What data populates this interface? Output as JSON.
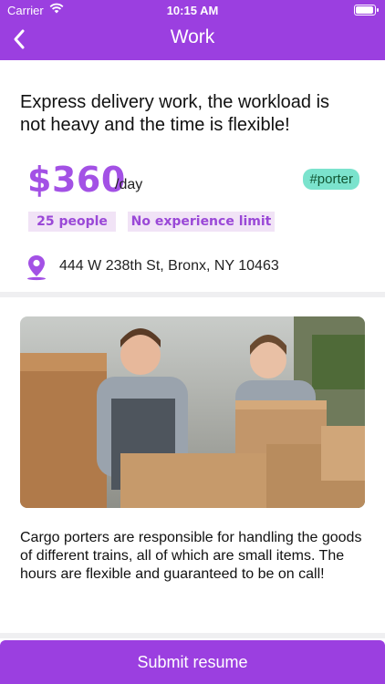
{
  "status_bar": {
    "carrier": "Carrier",
    "time": "10:15 AM"
  },
  "nav": {
    "title": "Work"
  },
  "job": {
    "title": "Express delivery work, the workload is not heavy and the time is flexible!",
    "salary": "$360",
    "salary_unit": "/day",
    "tag": "#porter",
    "people": "25 people",
    "experience": "No experience limit",
    "address": "444 W 238th St, Bronx, NY 10463",
    "description": "Cargo porters are responsible for handling the goods of different trains, all of which are small items. The hours are flexible and guaranteed to be on call!"
  },
  "submit": {
    "label": "Submit resume"
  },
  "colors": {
    "accent": "#9b3fe0",
    "salary": "#a351e5",
    "tag_bg": "#7be3cd",
    "pill_bg": "#f1e3f6"
  }
}
